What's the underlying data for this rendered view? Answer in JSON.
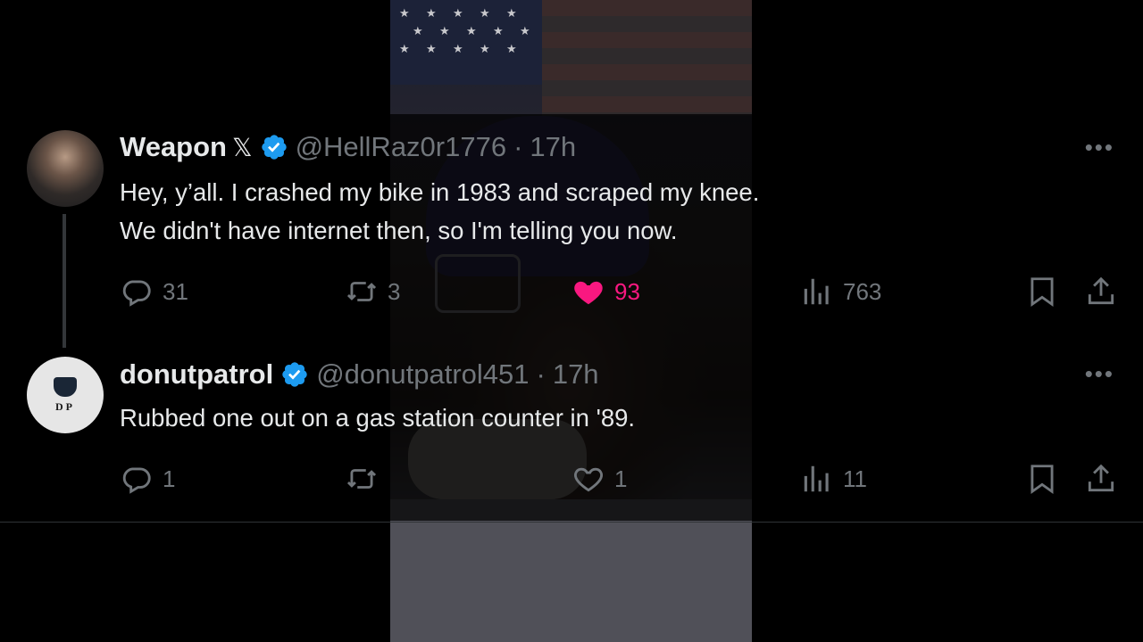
{
  "tweets": [
    {
      "name": "Weapon",
      "x_badge": "𝕏",
      "handle": "@HellRaz0r1776",
      "sep": "·",
      "time": "17h",
      "text_line1": "Hey, y’all. I crashed my bike in 1983 and scraped my knee.",
      "text_line2": "We didn't have internet then, so I'm telling you now.",
      "replies": "31",
      "retweets": "3",
      "likes": "93",
      "views": "763",
      "liked": true
    },
    {
      "name": "donutpatrol",
      "handle": "@donutpatrol451",
      "sep": "·",
      "time": "17h",
      "avatar_text": "DP",
      "text_line1": "Rubbed one out on a gas station counter in '89.",
      "replies": "1",
      "retweets": "",
      "likes": "1",
      "views": "11",
      "liked": false
    }
  ],
  "icons": {
    "more": "more-horizontal-icon",
    "reply": "reply-icon",
    "retweet": "retweet-icon",
    "like": "heart-icon",
    "views": "views-icon",
    "bookmark": "bookmark-icon",
    "share": "share-icon",
    "verified": "verified-badge-icon"
  },
  "colors": {
    "background": "#000000",
    "text": "#e7e9ea",
    "muted": "#71767b",
    "verified": "#1d9bf0",
    "like": "#f91880"
  }
}
